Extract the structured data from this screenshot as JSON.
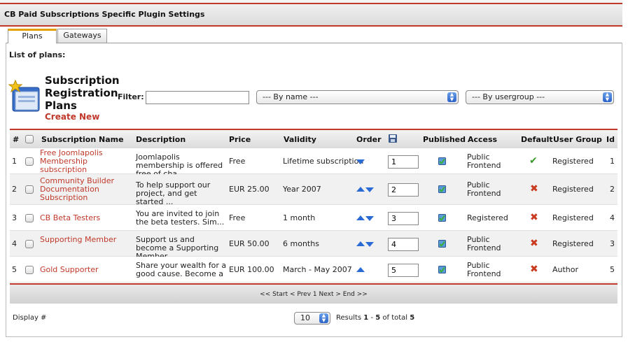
{
  "header": {
    "title": "CB Paid Subscriptions Specific Plugin Settings"
  },
  "tabs": [
    {
      "label": "Plans",
      "active": true
    },
    {
      "label": "Gateways",
      "active": false
    }
  ],
  "list_label": "List of plans:",
  "toolbar": {
    "title_line1": "Subscription",
    "title_line2": "Registration",
    "title_line3": "Plans",
    "create_new": "Create New",
    "filter_label": "Filter:",
    "filter_value": "",
    "sort_select": "--- By name ---",
    "usergroup_select": "--- By usergroup ---"
  },
  "columns": {
    "num": "#",
    "name": "Subscription Name",
    "description": "Description",
    "price": "Price",
    "validity": "Validity",
    "order": "Order",
    "published": "Published",
    "access": "Access",
    "default": "Default",
    "usergroup": "User Group",
    "id": "Id"
  },
  "rows": [
    {
      "num": "1",
      "name": "Free Joomlapolis Membership subscription",
      "description": "Joomlapolis membership is offered free of cha...",
      "price": "Free",
      "validity": "Lifetime subscription",
      "order_up": false,
      "order_down": true,
      "order": "1",
      "published": true,
      "access": "Public Frontend",
      "default": true,
      "usergroup": "Registered",
      "id": "1"
    },
    {
      "num": "2",
      "name": "Community Builder Documentation Subscription",
      "description": "To help support our project, and get started ...",
      "price": "EUR 25.00",
      "validity": "Year 2007",
      "order_up": true,
      "order_down": true,
      "order": "2",
      "published": true,
      "access": "Public Frontend",
      "default": false,
      "usergroup": "Registered",
      "id": "2"
    },
    {
      "num": "3",
      "name": "CB Beta Testers",
      "description": "You are invited to join the beta testers. Sim...",
      "price": "Free",
      "validity": "1 month",
      "order_up": true,
      "order_down": true,
      "order": "3",
      "published": true,
      "access": "Registered",
      "default": false,
      "usergroup": "Registered",
      "id": "4"
    },
    {
      "num": "4",
      "name": "Supporting Member",
      "description": "Support us and become a Supporting Member....",
      "price": "EUR 50.00",
      "validity": "6 months",
      "order_up": true,
      "order_down": true,
      "order": "4",
      "published": true,
      "access": "Public Frontend",
      "default": false,
      "usergroup": "Registered",
      "id": "3"
    },
    {
      "num": "5",
      "name": "Gold Supporter",
      "description": "Share your wealth for a good cause. Become a ...",
      "price": "EUR 100.00",
      "validity": "March - May 2007",
      "order_up": true,
      "order_down": false,
      "order": "5",
      "published": true,
      "access": "Public Frontend",
      "default": false,
      "usergroup": "Author",
      "id": "5"
    }
  ],
  "pagination": {
    "start": "<< Start",
    "prev": "< Prev",
    "page": "1",
    "next": "Next >",
    "end": "End >>"
  },
  "footer": {
    "display_label": "Display #",
    "display_value": "10",
    "results_prefix": "Results",
    "results_from": "1",
    "results_dash": "-",
    "results_to": "5",
    "results_of": "of total",
    "results_total": "5"
  },
  "colors": {
    "accent": "#c0392b",
    "tab_active": "#e5a000",
    "select_arrow": "#2a62c8",
    "default_yes": "#3a9a2a",
    "default_no": "#c93a1f"
  }
}
